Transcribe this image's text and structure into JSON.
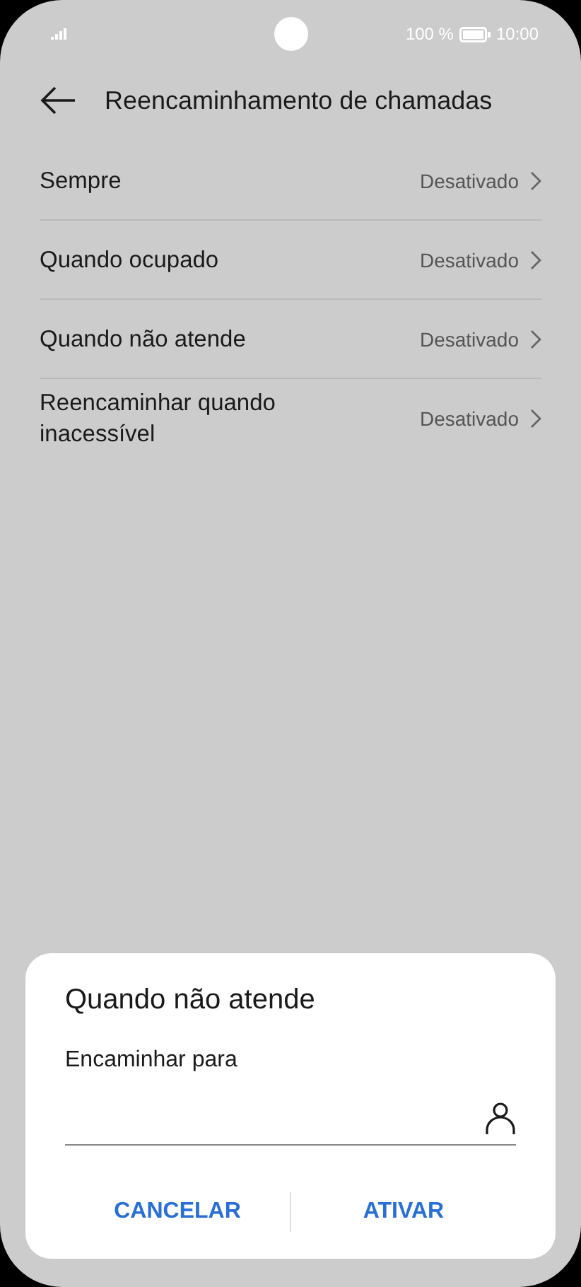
{
  "status_bar": {
    "battery": "100 %",
    "time": "10:00"
  },
  "header": {
    "title": "Reencaminhamento de chamadas"
  },
  "settings": [
    {
      "label": "Sempre",
      "value": "Desativado"
    },
    {
      "label": "Quando ocupado",
      "value": "Desativado"
    },
    {
      "label": "Quando não atende",
      "value": "Desativado"
    },
    {
      "label": "Reencaminhar quando inacessível",
      "value": "Desativado"
    }
  ],
  "dialog": {
    "title": "Quando não atende",
    "field_label": "Encaminhar para",
    "buttons": [
      "CANCELAR",
      "ATIVAR"
    ]
  }
}
